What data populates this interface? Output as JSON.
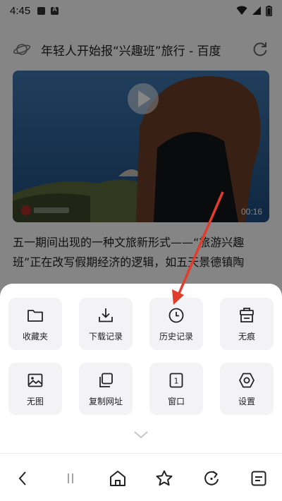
{
  "status_bar": {
    "time": "4:45",
    "icons": [
      "image-icon",
      "a-badge-icon",
      "wifi-icon",
      "signal-icon",
      "battery-icon"
    ]
  },
  "page": {
    "title": "年轻人开始报“兴趣班”旅行 - 百度",
    "video": {
      "duration": "00:16"
    },
    "article_text": "五一期间出现的一种文旅新形式——“旅游兴趣班”正在改写假期经济的逻辑，如五天景德镇陶"
  },
  "menu": {
    "row1": [
      {
        "label": "收藏夹",
        "icon": "folder-icon"
      },
      {
        "label": "下载记录",
        "icon": "download-icon"
      },
      {
        "label": "历史记录",
        "icon": "clock-icon"
      },
      {
        "label": "无痕",
        "icon": "incognito-icon"
      }
    ],
    "row2": [
      {
        "label": "无图",
        "icon": "image-icon"
      },
      {
        "label": "复制网址",
        "icon": "copy-icon"
      },
      {
        "label": "窗口",
        "icon": "window-count-icon",
        "count": "1"
      },
      {
        "label": "设置",
        "icon": "settings-icon"
      }
    ]
  },
  "bottom_nav": [
    "back-icon",
    "pause-icon",
    "home-icon",
    "star-icon",
    "refresh-icon",
    "menu-icon"
  ],
  "colors": {
    "accent": "#e23c2c",
    "sheet": "#ffffff",
    "tile": "#f3f3f5"
  }
}
